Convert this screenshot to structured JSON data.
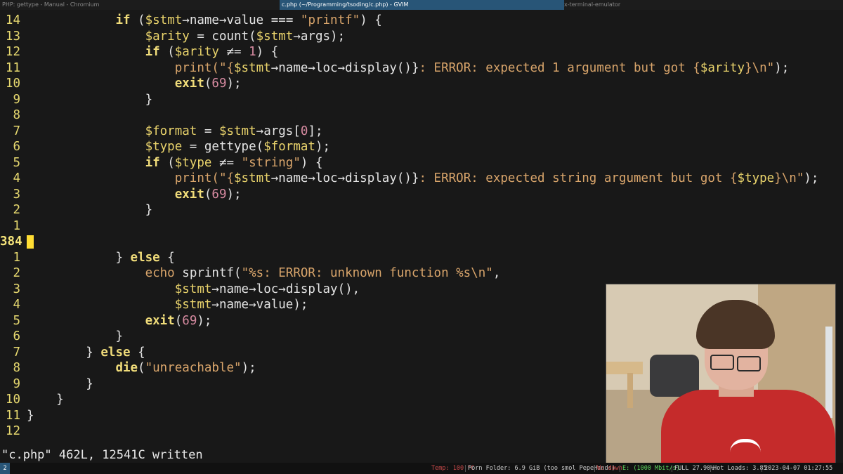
{
  "topbar": {
    "tabs": [
      {
        "label": "PHP: gettype - Manual - Chromium",
        "active": false
      },
      {
        "label": "c.php (~/Programming/tsoding/c.php) - GVIM",
        "active": true
      },
      {
        "label": "x-terminal-emulator",
        "active": false
      }
    ]
  },
  "editor": {
    "cursor_line_number": "384",
    "lines": [
      {
        "num": "14",
        "tokens": [
          [
            "            ",
            ""
          ],
          [
            "if",
            "kw"
          ],
          [
            " (",
            ""
          ],
          [
            "$stmt",
            "var"
          ],
          [
            "→",
            "op"
          ],
          [
            "name",
            ""
          ],
          [
            "→",
            "op"
          ],
          [
            "value",
            ""
          ],
          [
            " === ",
            "op"
          ],
          [
            "\"printf\"",
            "str"
          ],
          [
            ") {",
            ""
          ]
        ]
      },
      {
        "num": "13",
        "tokens": [
          [
            "                ",
            ""
          ],
          [
            "$arity",
            "var"
          ],
          [
            " = ",
            ""
          ],
          [
            "count",
            ""
          ],
          [
            "(",
            ""
          ],
          [
            "$stmt",
            "var"
          ],
          [
            "→",
            "op"
          ],
          [
            "args",
            ""
          ],
          [
            ");",
            ""
          ]
        ]
      },
      {
        "num": "12",
        "tokens": [
          [
            "                ",
            ""
          ],
          [
            "if",
            "kw"
          ],
          [
            " (",
            ""
          ],
          [
            "$arity",
            "var"
          ],
          [
            " ≠= ",
            "op"
          ],
          [
            "1",
            "num"
          ],
          [
            ") {",
            ""
          ]
        ]
      },
      {
        "num": "11",
        "tokens": [
          [
            "                    ",
            ""
          ],
          [
            "print",
            "str"
          ],
          [
            "(\"{",
            "str"
          ],
          [
            "$stmt",
            "var"
          ],
          [
            "→",
            "op"
          ],
          [
            "name",
            ""
          ],
          [
            "→",
            "op"
          ],
          [
            "loc",
            ""
          ],
          [
            "→",
            "op"
          ],
          [
            "display",
            ""
          ],
          [
            "()}",
            ""
          ],
          [
            ": ERROR: expected 1 argument but got {",
            "str"
          ],
          [
            "$arity",
            "var"
          ],
          [
            "}\\n\"",
            "str"
          ],
          [
            ");",
            ""
          ]
        ]
      },
      {
        "num": "10",
        "tokens": [
          [
            "                    ",
            ""
          ],
          [
            "exit",
            "kw"
          ],
          [
            "(",
            ""
          ],
          [
            "69",
            "num"
          ],
          [
            ");",
            ""
          ]
        ]
      },
      {
        "num": "9",
        "tokens": [
          [
            "                ",
            ""
          ],
          [
            "}",
            ""
          ]
        ]
      },
      {
        "num": "8",
        "tokens": []
      },
      {
        "num": "7",
        "tokens": [
          [
            "                ",
            ""
          ],
          [
            "$format",
            "var"
          ],
          [
            " = ",
            ""
          ],
          [
            "$stmt",
            "var"
          ],
          [
            "→",
            "op"
          ],
          [
            "args",
            ""
          ],
          [
            "[",
            ""
          ],
          [
            "0",
            "num"
          ],
          [
            "];",
            ""
          ]
        ]
      },
      {
        "num": "6",
        "tokens": [
          [
            "                ",
            ""
          ],
          [
            "$type",
            "var"
          ],
          [
            " = ",
            ""
          ],
          [
            "gettype",
            ""
          ],
          [
            "(",
            ""
          ],
          [
            "$format",
            "var"
          ],
          [
            ");",
            ""
          ]
        ]
      },
      {
        "num": "5",
        "tokens": [
          [
            "                ",
            ""
          ],
          [
            "if",
            "kw"
          ],
          [
            " (",
            ""
          ],
          [
            "$type",
            "var"
          ],
          [
            " ≠= ",
            "op"
          ],
          [
            "\"string\"",
            "str"
          ],
          [
            ") {",
            ""
          ]
        ]
      },
      {
        "num": "4",
        "tokens": [
          [
            "                    ",
            ""
          ],
          [
            "print",
            "str"
          ],
          [
            "(\"{",
            "str"
          ],
          [
            "$stmt",
            "var"
          ],
          [
            "→",
            "op"
          ],
          [
            "name",
            ""
          ],
          [
            "→",
            "op"
          ],
          [
            "loc",
            ""
          ],
          [
            "→",
            "op"
          ],
          [
            "display",
            ""
          ],
          [
            "()}",
            ""
          ],
          [
            ": ERROR: expected string argument but got {",
            "str"
          ],
          [
            "$type",
            "var"
          ],
          [
            "}\\n\"",
            "str"
          ],
          [
            ");",
            ""
          ]
        ]
      },
      {
        "num": "3",
        "tokens": [
          [
            "                    ",
            ""
          ],
          [
            "exit",
            "kw"
          ],
          [
            "(",
            ""
          ],
          [
            "69",
            "num"
          ],
          [
            ");",
            ""
          ]
        ]
      },
      {
        "num": "2",
        "tokens": [
          [
            "                ",
            ""
          ],
          [
            "}",
            ""
          ]
        ]
      },
      {
        "num": "1",
        "tokens": []
      },
      {
        "num": "384",
        "tokens": [],
        "current": true
      },
      {
        "num": "1",
        "tokens": [
          [
            "            ",
            ""
          ],
          [
            "}",
            ""
          ],
          [
            " ",
            ""
          ],
          [
            "else",
            "kw"
          ],
          [
            " {",
            ""
          ]
        ]
      },
      {
        "num": "2",
        "tokens": [
          [
            "                ",
            ""
          ],
          [
            "echo",
            "str"
          ],
          [
            " ",
            ""
          ],
          [
            "sprintf",
            ""
          ],
          [
            "(",
            ""
          ],
          [
            "\"%s: ERROR: unknown function %s\\n\"",
            "str"
          ],
          [
            ",",
            ""
          ]
        ]
      },
      {
        "num": "3",
        "tokens": [
          [
            "                    ",
            ""
          ],
          [
            "$stmt",
            "var"
          ],
          [
            "→",
            "op"
          ],
          [
            "name",
            ""
          ],
          [
            "→",
            "op"
          ],
          [
            "loc",
            ""
          ],
          [
            "→",
            "op"
          ],
          [
            "display",
            ""
          ],
          [
            "(),",
            ""
          ]
        ]
      },
      {
        "num": "4",
        "tokens": [
          [
            "                    ",
            ""
          ],
          [
            "$stmt",
            "var"
          ],
          [
            "→",
            "op"
          ],
          [
            "name",
            ""
          ],
          [
            "→",
            "op"
          ],
          [
            "value",
            ""
          ],
          [
            ");",
            ""
          ]
        ]
      },
      {
        "num": "5",
        "tokens": [
          [
            "                ",
            ""
          ],
          [
            "exit",
            "kw"
          ],
          [
            "(",
            ""
          ],
          [
            "69",
            "num"
          ],
          [
            ");",
            ""
          ]
        ]
      },
      {
        "num": "6",
        "tokens": [
          [
            "            ",
            ""
          ],
          [
            "}",
            ""
          ]
        ]
      },
      {
        "num": "7",
        "tokens": [
          [
            "        ",
            ""
          ],
          [
            "}",
            ""
          ],
          [
            " ",
            ""
          ],
          [
            "else",
            "kw"
          ],
          [
            " {",
            ""
          ]
        ]
      },
      {
        "num": "8",
        "tokens": [
          [
            "            ",
            ""
          ],
          [
            "die",
            "kw"
          ],
          [
            "(",
            ""
          ],
          [
            "\"unreachable\"",
            "str"
          ],
          [
            ");",
            ""
          ]
        ]
      },
      {
        "num": "9",
        "tokens": [
          [
            "        ",
            ""
          ],
          [
            "}",
            ""
          ]
        ]
      },
      {
        "num": "10",
        "tokens": [
          [
            "    ",
            ""
          ],
          [
            "}",
            ""
          ]
        ]
      },
      {
        "num": "11",
        "tokens": [
          [
            "",
            ""
          ],
          [
            "}",
            ""
          ]
        ]
      },
      {
        "num": "12",
        "tokens": []
      }
    ],
    "command_line": "\"c.php\" 462L, 12541C written"
  },
  "statusbar": {
    "workspace": "2",
    "items": [
      {
        "text": "Temp: 100 °C",
        "color": "#c94a4a"
      },
      {
        "text": "Porn Folder: 6.9 GiB (too smol PepeHands)",
        "color": "#cfcfcf"
      },
      {
        "text": "W: down",
        "color": "#c94a4a"
      },
      {
        "text": "E: (1000 Mbit/s)",
        "color": "#5fd75f"
      },
      {
        "text": "FULL 27.90%",
        "color": "#cfcfcf"
      },
      {
        "text": "Hot Loads: 3.85",
        "color": "#cfcfcf"
      },
      {
        "text": "2023-04-07 01:27:55",
        "color": "#cfcfcf"
      }
    ]
  }
}
